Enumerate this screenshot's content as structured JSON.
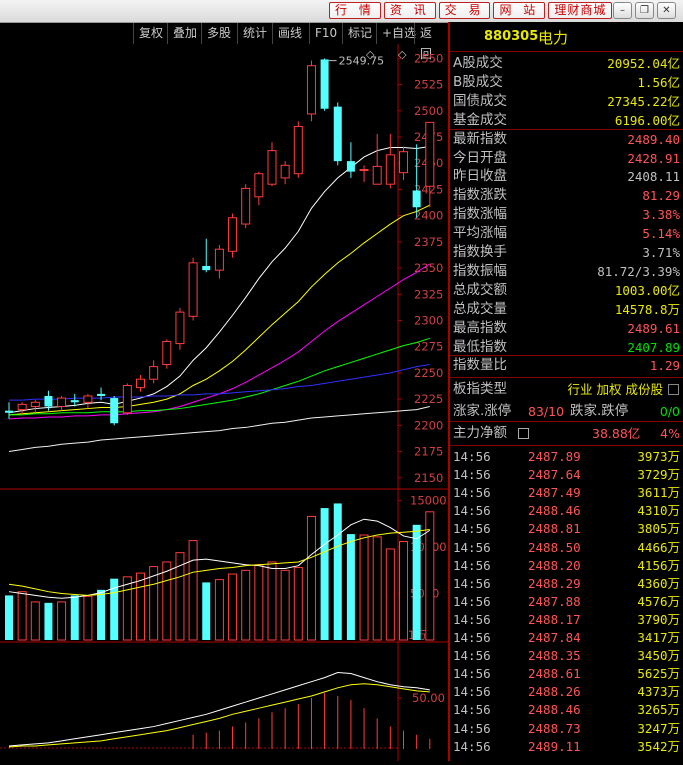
{
  "topnav": [
    "行 情",
    "资 讯",
    "交 易",
    "网 站",
    "理财商城"
  ],
  "winbtns": [
    "–",
    "❐",
    "✕"
  ],
  "toolbar": [
    "复权",
    "叠加",
    "多股",
    "统计",
    "画线",
    "F10",
    "标记",
    "+自选",
    "返回"
  ],
  "diamond_icon": "diamond-icon",
  "colors": {
    "up": "#ff3c3c",
    "down": "#54ffff",
    "ma1": "#ffffff",
    "ma2": "#ffff00",
    "ma3": "#ff00ff",
    "ma4": "#00ff00",
    "ma5": "#f0f0f0",
    "ma6": "#3030ff",
    "axis": "#b00000"
  },
  "chart_data": [
    {
      "type": "candlestick",
      "price_axis_ticks": [
        "2550",
        "2525",
        "2500",
        "2475",
        "2450",
        "2425",
        "2400",
        "2375",
        "2350",
        "2325",
        "2300",
        "2275",
        "2250",
        "2225",
        "2200",
        "2175",
        "2150"
      ],
      "ylim": [
        2145,
        2558
      ],
      "high_annotation": "2549.75",
      "candles": [
        {
          "o": 2214,
          "h": 2222,
          "l": 2206,
          "c": 2212
        },
        {
          "o": 2215,
          "h": 2222,
          "l": 2210,
          "c": 2220
        },
        {
          "o": 2218,
          "h": 2224,
          "l": 2212,
          "c": 2222
        },
        {
          "o": 2228,
          "h": 2233,
          "l": 2214,
          "c": 2218
        },
        {
          "o": 2218,
          "h": 2228,
          "l": 2214,
          "c": 2226
        },
        {
          "o": 2224,
          "h": 2230,
          "l": 2218,
          "c": 2222
        },
        {
          "o": 2222,
          "h": 2230,
          "l": 2216,
          "c": 2228
        },
        {
          "o": 2230,
          "h": 2236,
          "l": 2224,
          "c": 2228
        },
        {
          "o": 2226,
          "h": 2228,
          "l": 2200,
          "c": 2202
        },
        {
          "o": 2212,
          "h": 2240,
          "l": 2210,
          "c": 2238
        },
        {
          "o": 2236,
          "h": 2248,
          "l": 2232,
          "c": 2244
        },
        {
          "o": 2244,
          "h": 2262,
          "l": 2240,
          "c": 2256
        },
        {
          "o": 2258,
          "h": 2282,
          "l": 2254,
          "c": 2280
        },
        {
          "o": 2278,
          "h": 2312,
          "l": 2272,
          "c": 2308
        },
        {
          "o": 2304,
          "h": 2360,
          "l": 2300,
          "c": 2355
        },
        {
          "o": 2352,
          "h": 2378,
          "l": 2346,
          "c": 2348
        },
        {
          "o": 2348,
          "h": 2372,
          "l": 2340,
          "c": 2368
        },
        {
          "o": 2366,
          "h": 2402,
          "l": 2360,
          "c": 2398
        },
        {
          "o": 2392,
          "h": 2430,
          "l": 2388,
          "c": 2426
        },
        {
          "o": 2418,
          "h": 2442,
          "l": 2410,
          "c": 2440
        },
        {
          "o": 2430,
          "h": 2470,
          "l": 2428,
          "c": 2462
        },
        {
          "o": 2436,
          "h": 2452,
          "l": 2430,
          "c": 2448
        },
        {
          "o": 2440,
          "h": 2490,
          "l": 2436,
          "c": 2485
        },
        {
          "o": 2497,
          "h": 2548,
          "l": 2490,
          "c": 2543
        },
        {
          "o": 2549,
          "h": 2550,
          "l": 2500,
          "c": 2502
        },
        {
          "o": 2504,
          "h": 2508,
          "l": 2448,
          "c": 2452
        },
        {
          "o": 2452,
          "h": 2470,
          "l": 2436,
          "c": 2442
        },
        {
          "o": 2444,
          "h": 2448,
          "l": 2432,
          "c": 2444
        },
        {
          "o": 2430,
          "h": 2478,
          "l": 2430,
          "c": 2447
        },
        {
          "o": 2430,
          "h": 2478,
          "l": 2426,
          "c": 2458
        },
        {
          "o": 2441,
          "h": 2466,
          "l": 2434,
          "c": 2461
        },
        {
          "o": 2424,
          "h": 2468,
          "l": 2398,
          "c": 2408
        },
        {
          "o": 2428,
          "h": 2489,
          "l": 2408,
          "c": 2489
        }
      ],
      "ma": [
        {
          "color": "#ffffff",
          "values": [
            2212,
            2214,
            2216,
            2217,
            2218,
            2219,
            2221,
            2222,
            2220,
            2223,
            2226,
            2230,
            2237,
            2247,
            2262,
            2274,
            2289,
            2305,
            2322,
            2340,
            2356,
            2369,
            2385,
            2407,
            2423,
            2436,
            2446,
            2456,
            2462,
            2465,
            2465,
            2464,
            2466
          ]
        },
        {
          "color": "#ffff00",
          "values": [
            2210,
            2211,
            2212,
            2213,
            2214,
            2215,
            2216,
            2217,
            2217,
            2218,
            2220,
            2222,
            2225,
            2230,
            2238,
            2244,
            2252,
            2261,
            2272,
            2284,
            2296,
            2307,
            2318,
            2332,
            2344,
            2355,
            2364,
            2374,
            2383,
            2392,
            2400,
            2404,
            2410
          ]
        },
        {
          "color": "#ff00ff",
          "values": [
            2206,
            2207,
            2207,
            2208,
            2208,
            2209,
            2209,
            2210,
            2210,
            2211,
            2212,
            2213,
            2215,
            2218,
            2222,
            2226,
            2230,
            2235,
            2241,
            2248,
            2255,
            2262,
            2270,
            2280,
            2290,
            2299,
            2307,
            2315,
            2323,
            2331,
            2339,
            2346,
            2354
          ]
        },
        {
          "color": "#00ff00",
          "values": [
            2210,
            2210,
            2211,
            2211,
            2212,
            2212,
            2212,
            2213,
            2213,
            2213,
            2214,
            2214,
            2215,
            2216,
            2218,
            2220,
            2222,
            2224,
            2227,
            2230,
            2234,
            2238,
            2242,
            2247,
            2252,
            2256,
            2260,
            2264,
            2268,
            2272,
            2276,
            2279,
            2283
          ]
        },
        {
          "color": "#f0f0f0",
          "values": [
            2175,
            2177,
            2179,
            2180,
            2182,
            2183,
            2184,
            2186,
            2187,
            2188,
            2189,
            2190,
            2191,
            2192,
            2193,
            2194,
            2195,
            2197,
            2198,
            2200,
            2202,
            2203,
            2205,
            2207,
            2208,
            2209,
            2210,
            2211,
            2212,
            2213,
            2214,
            2215,
            2218
          ]
        },
        {
          "color": "#3030ff",
          "values": [
            2224,
            2224,
            2225,
            2225,
            2225,
            2226,
            2226,
            2226,
            2227,
            2227,
            2227,
            2228,
            2228,
            2229,
            2229,
            2230,
            2230,
            2231,
            2232,
            2233,
            2234,
            2235,
            2237,
            2238,
            2240,
            2242,
            2244,
            2246,
            2248,
            2250,
            2253,
            2256,
            2258
          ]
        }
      ]
    },
    {
      "type": "bar",
      "axis_ticks": [
        "15000",
        "10000",
        "5000"
      ],
      "ylim": [
        0,
        15500
      ],
      "unit_label": "X1万",
      "values": [
        4800,
        5200,
        4100,
        4000,
        4100,
        4800,
        4700,
        5400,
        6600,
        6800,
        7200,
        7900,
        8400,
        9400,
        10700,
        6200,
        6500,
        7100,
        7500,
        8100,
        8400,
        7500,
        7800,
        13300,
        14200,
        14700,
        11400,
        11300,
        11100,
        9800,
        10600,
        12400,
        13800,
        14700
      ],
      "ma": [
        {
          "color": "#ffffff",
          "values": [
            5200,
            5000,
            4800,
            4600,
            4500,
            4600,
            4800,
            5100,
            5600,
            6000,
            6400,
            6900,
            7400,
            8000,
            8600,
            8700,
            8500,
            8300,
            8100,
            8000,
            7700,
            7700,
            8000,
            9200,
            10300,
            11300,
            12400,
            13000,
            12800,
            12100,
            11200,
            10900,
            11800,
            12600
          ]
        },
        {
          "color": "#ffff00",
          "values": [
            6000,
            5800,
            5500,
            5200,
            5000,
            4900,
            4800,
            4900,
            5100,
            5400,
            5700,
            6000,
            6400,
            6800,
            7300,
            7500,
            7700,
            7800,
            8000,
            8100,
            8200,
            8300,
            8400,
            8900,
            9500,
            10100,
            10600,
            11000,
            11300,
            11500,
            11600,
            11700,
            11900,
            12100
          ]
        }
      ]
    },
    {
      "type": "line",
      "axis_ticks": [
        "50.00"
      ],
      "ylim": [
        0,
        100
      ],
      "lines": [
        {
          "color": "#ffffff",
          "values": [
            3,
            4,
            5,
            6,
            8,
            10,
            12,
            14,
            16,
            18,
            20,
            22,
            25,
            28,
            31,
            34,
            38,
            42,
            46,
            50,
            54,
            58,
            62,
            66,
            70,
            75,
            74,
            70,
            66,
            63,
            61,
            60,
            58,
            55
          ]
        },
        {
          "color": "#ffff00",
          "values": [
            2,
            3,
            3,
            4,
            5,
            6,
            7,
            8,
            10,
            12,
            14,
            16,
            18,
            21,
            24,
            27,
            30,
            34,
            37,
            40,
            43,
            46,
            49,
            52,
            56,
            60,
            63,
            64,
            63,
            61,
            59,
            57,
            56,
            54
          ]
        }
      ],
      "bars": [
        0,
        0,
        0,
        0,
        0,
        0,
        0,
        0,
        0,
        0,
        0,
        0,
        0,
        0,
        14,
        16,
        18,
        22,
        26,
        30,
        36,
        40,
        44,
        50,
        55,
        52,
        48,
        40,
        30,
        22,
        18,
        14,
        10,
        4
      ]
    }
  ],
  "quote": {
    "code": "880305",
    "name": "电力",
    "rows": [
      {
        "label": "A股成交",
        "value": "20952.04亿",
        "color": "yel"
      },
      {
        "label": "B股成交",
        "value": "1.56亿",
        "color": "yel"
      },
      {
        "label": "国债成交",
        "value": "27345.22亿",
        "color": "yel"
      },
      {
        "label": "基金成交",
        "value": "6196.00亿",
        "color": "yel"
      },
      {
        "label": "最新指数",
        "value": "2489.40",
        "color": "red"
      },
      {
        "label": "今日开盘",
        "value": "2428.91",
        "color": "red"
      },
      {
        "label": "昨日收盘",
        "value": "2408.11",
        "color": "gry"
      },
      {
        "label": "指数涨跌",
        "value": "81.29",
        "color": "red"
      },
      {
        "label": "指数涨幅",
        "value": "3.38%",
        "color": "red"
      },
      {
        "label": "平均涨幅",
        "value": "5.14%",
        "color": "red"
      },
      {
        "label": "指数换手",
        "value": "3.71%",
        "color": "gry"
      },
      {
        "label": "指数振幅",
        "value": "81.72/3.39%",
        "color": "gry"
      },
      {
        "label": "总成交额",
        "value": "1003.00亿",
        "color": "yel"
      },
      {
        "label": "总成交量",
        "value": "14578.8万",
        "color": "yel"
      },
      {
        "label": "最高指数",
        "value": "2489.61",
        "color": "red"
      },
      {
        "label": "最低指数",
        "value": "2407.89",
        "color": "grn"
      },
      {
        "label": "指数量比",
        "value": "1.29",
        "color": "red"
      }
    ],
    "type_label": "板指类型",
    "type_value": "行业 加权 成份股",
    "up_label": "涨家.涨停",
    "up_value": "83/10",
    "down_label": "跌家.跌停",
    "down_value": "0/0",
    "flow_label": "主力净额",
    "flow_value": "38.88亿",
    "flow_pct": "4%"
  },
  "ticks": [
    {
      "t": "14:56",
      "p": "2487.89",
      "v": "3973万"
    },
    {
      "t": "14:56",
      "p": "2487.64",
      "v": "3729万"
    },
    {
      "t": "14:56",
      "p": "2487.49",
      "v": "3611万"
    },
    {
      "t": "14:56",
      "p": "2488.46",
      "v": "4310万"
    },
    {
      "t": "14:56",
      "p": "2488.81",
      "v": "3805万"
    },
    {
      "t": "14:56",
      "p": "2488.50",
      "v": "4466万"
    },
    {
      "t": "14:56",
      "p": "2488.20",
      "v": "4156万"
    },
    {
      "t": "14:56",
      "p": "2488.29",
      "v": "4360万"
    },
    {
      "t": "14:56",
      "p": "2487.88",
      "v": "4576万"
    },
    {
      "t": "14:56",
      "p": "2488.17",
      "v": "3790万"
    },
    {
      "t": "14:56",
      "p": "2487.84",
      "v": "3417万"
    },
    {
      "t": "14:56",
      "p": "2488.35",
      "v": "3450万"
    },
    {
      "t": "14:56",
      "p": "2488.61",
      "v": "5625万"
    },
    {
      "t": "14:56",
      "p": "2488.26",
      "v": "4373万"
    },
    {
      "t": "14:56",
      "p": "2488.46",
      "v": "3265万"
    },
    {
      "t": "14:56",
      "p": "2488.73",
      "v": "3247万"
    },
    {
      "t": "14:56",
      "p": "2489.11",
      "v": "3542万"
    }
  ]
}
